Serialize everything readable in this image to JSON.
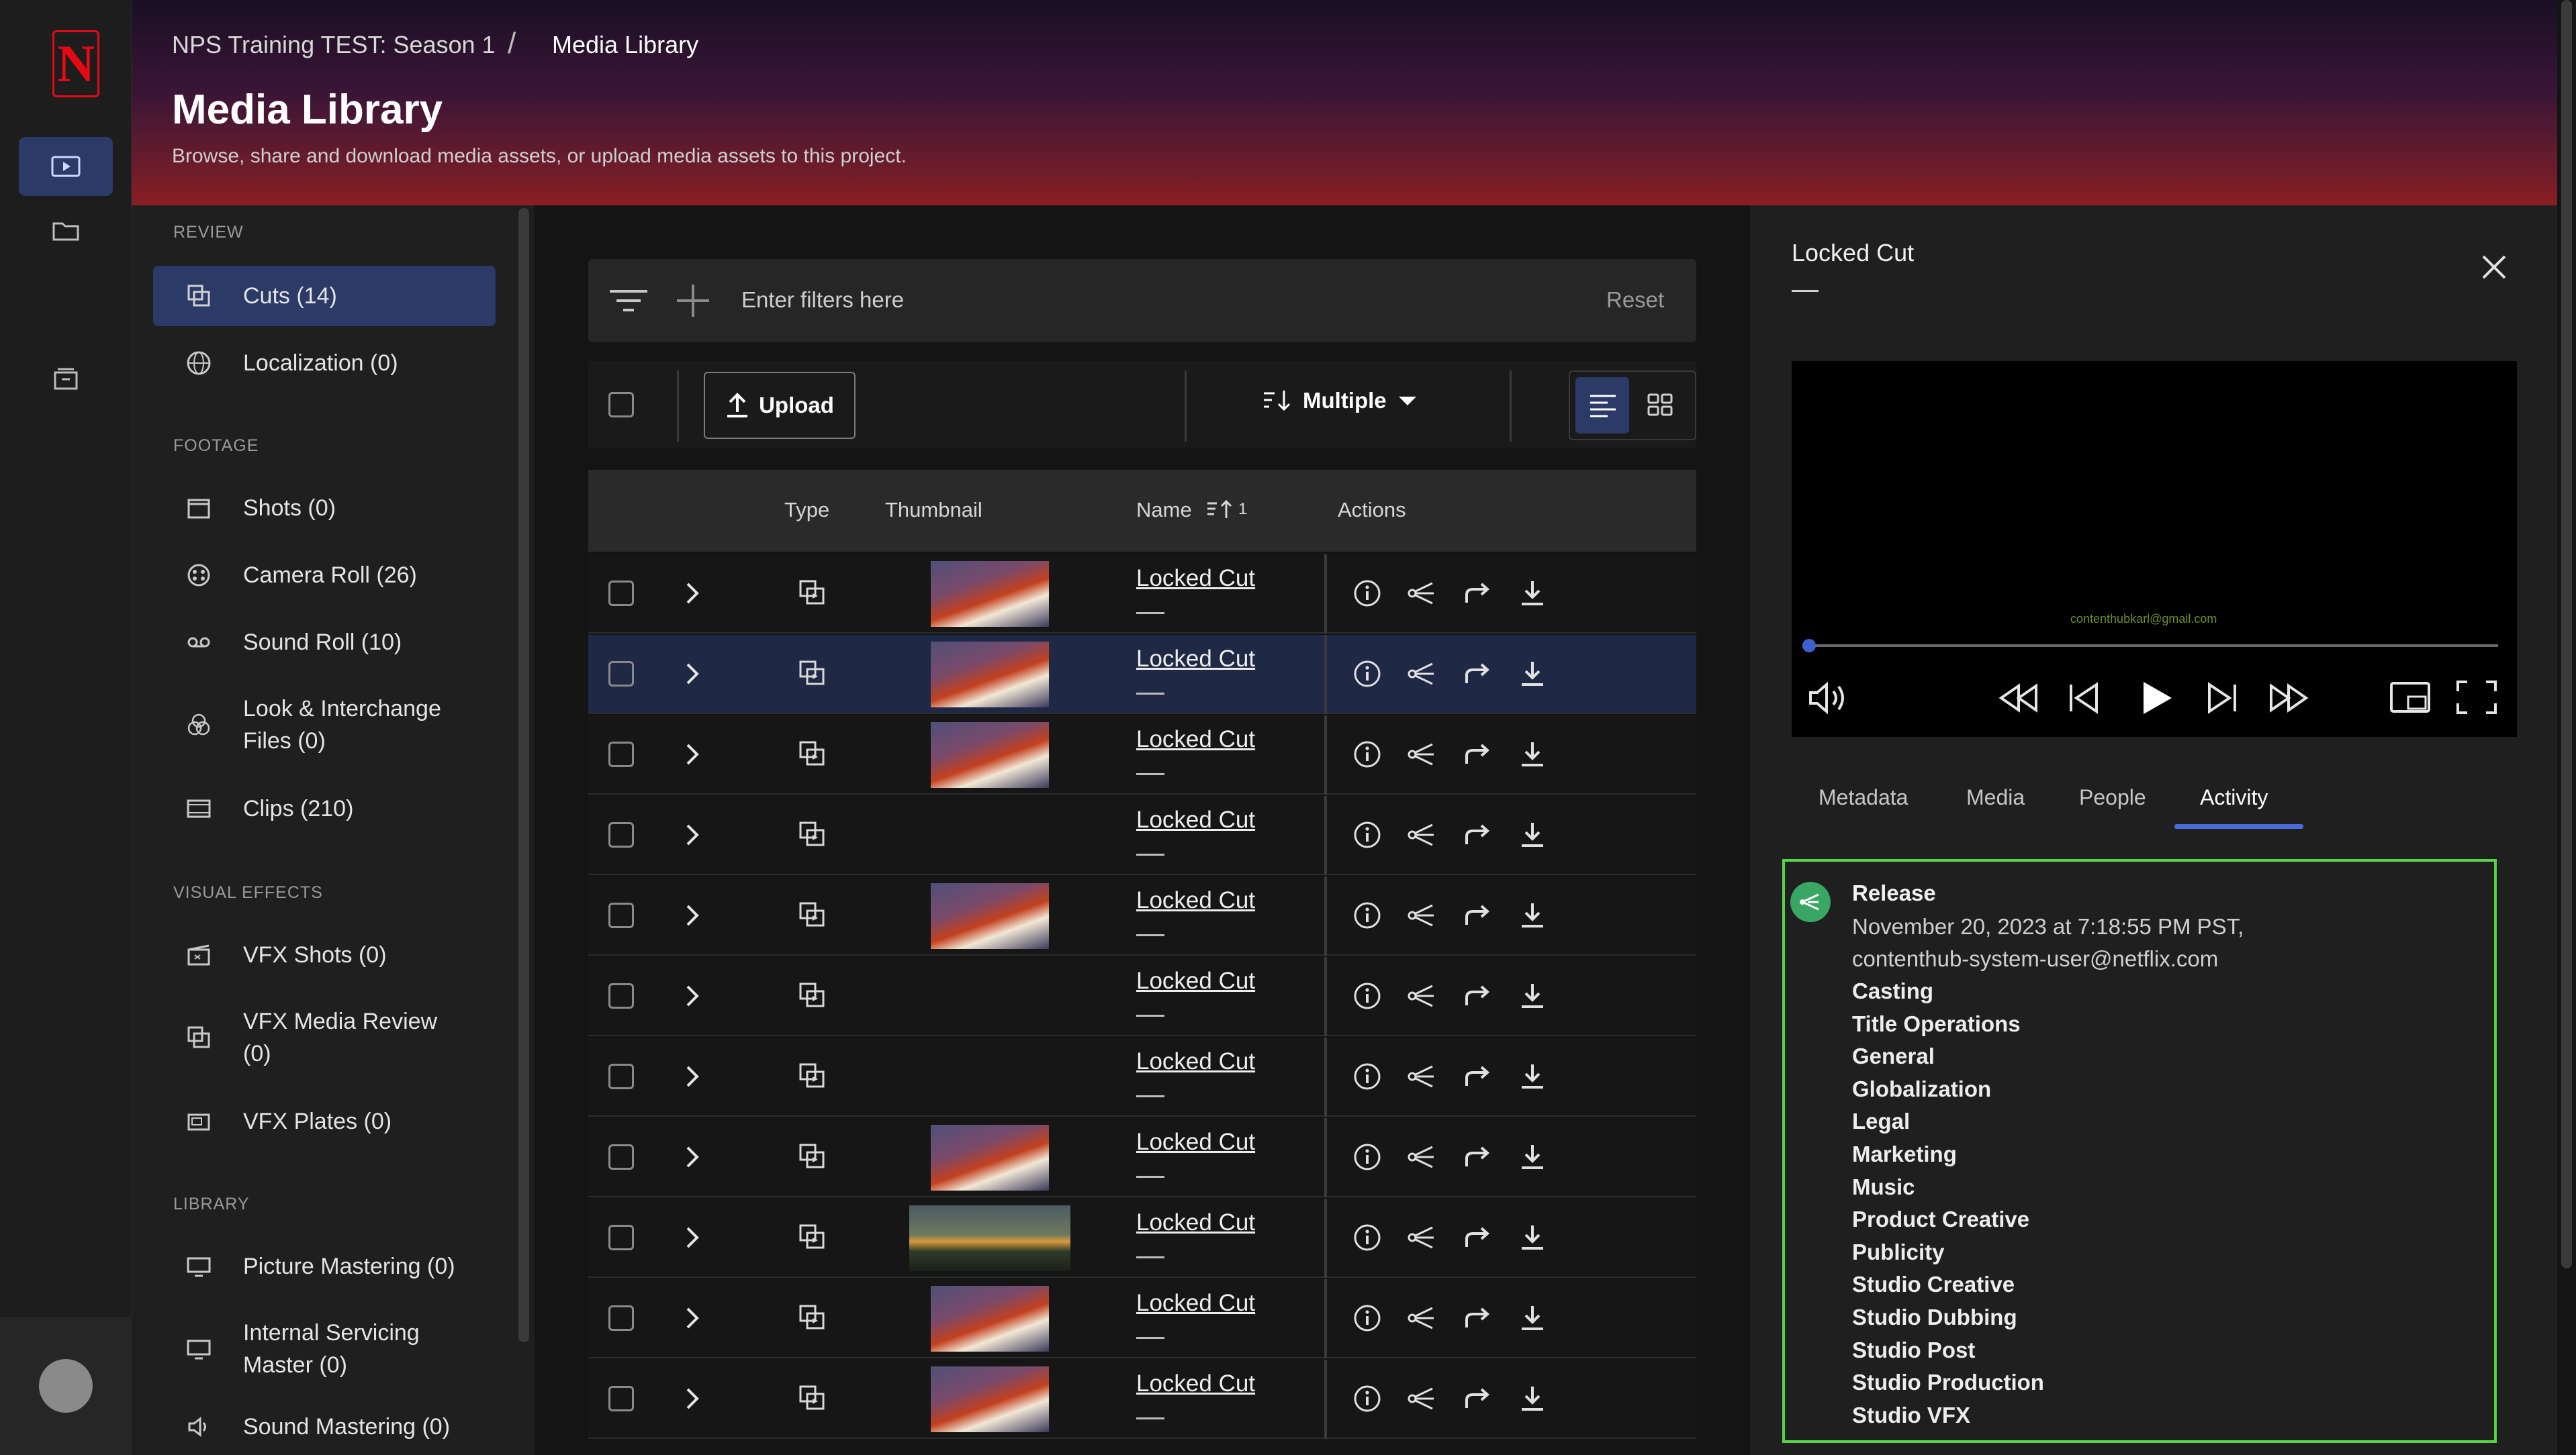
{
  "header": {
    "breadcrumb_project": "NPS Training TEST: Season 1",
    "breadcrumb_sep": "/",
    "breadcrumb_current": "Media Library",
    "title": "Media Library",
    "subtitle": "Browse, share and download media assets, or upload media assets to this project."
  },
  "sidebar": {
    "sections": [
      {
        "label": "REVIEW"
      },
      {
        "label": "FOOTAGE"
      },
      {
        "label": "VISUAL EFFECTS"
      },
      {
        "label": "LIBRARY"
      }
    ],
    "items": [
      {
        "label": "Cuts (14)"
      },
      {
        "label": "Localization (0)"
      },
      {
        "label": "Shots (0)"
      },
      {
        "label": "Camera Roll (26)"
      },
      {
        "label": "Sound Roll (10)"
      },
      {
        "label": "Look & Interchange Files (0)"
      },
      {
        "label": "Clips (210)"
      },
      {
        "label": "VFX Shots (0)"
      },
      {
        "label": "VFX Media Review (0)"
      },
      {
        "label": "VFX Plates (0)"
      },
      {
        "label": "Picture Mastering (0)"
      },
      {
        "label": "Internal Servicing Master (0)"
      },
      {
        "label": "Sound Mastering (0)"
      }
    ]
  },
  "filter": {
    "placeholder": "Enter filters here",
    "reset": "Reset"
  },
  "toolbar": {
    "upload": "Upload",
    "sort": "Multiple"
  },
  "table": {
    "headers": {
      "type": "Type",
      "thumbnail": "Thumbnail",
      "name": "Name",
      "sort_indicator": "1",
      "actions": "Actions"
    },
    "rows": [
      {
        "name": "Locked Cut"
      },
      {
        "name": "Locked Cut"
      },
      {
        "name": "Locked Cut"
      },
      {
        "name": "Locked Cut"
      },
      {
        "name": "Locked Cut"
      },
      {
        "name": "Locked Cut"
      },
      {
        "name": "Locked Cut"
      },
      {
        "name": "Locked Cut"
      },
      {
        "name": "Locked Cut"
      },
      {
        "name": "Locked Cut"
      },
      {
        "name": "Locked Cut"
      }
    ]
  },
  "panel": {
    "title": "Locked Cut",
    "watermark": "contenthubkarl@gmail.com",
    "tabs": [
      "Metadata",
      "Media",
      "People",
      "Activity"
    ],
    "activity": {
      "title": "Release",
      "date": "November 20, 2023 at 7:18:55 PM PST,",
      "user": "contenthub-system-user@netflix.com",
      "teams": [
        "Casting",
        "Title Operations",
        "General",
        "Globalization",
        "Legal",
        "Marketing",
        "Music",
        "Product Creative",
        "Publicity",
        "Studio Creative",
        "Studio Dubbing",
        "Studio Post",
        "Studio Production",
        "Studio VFX"
      ]
    }
  },
  "colors": {
    "accent": "#2b3a66",
    "active_tab": "#4a6bd8",
    "highlight": "#58d246",
    "brand": "#e50914"
  }
}
